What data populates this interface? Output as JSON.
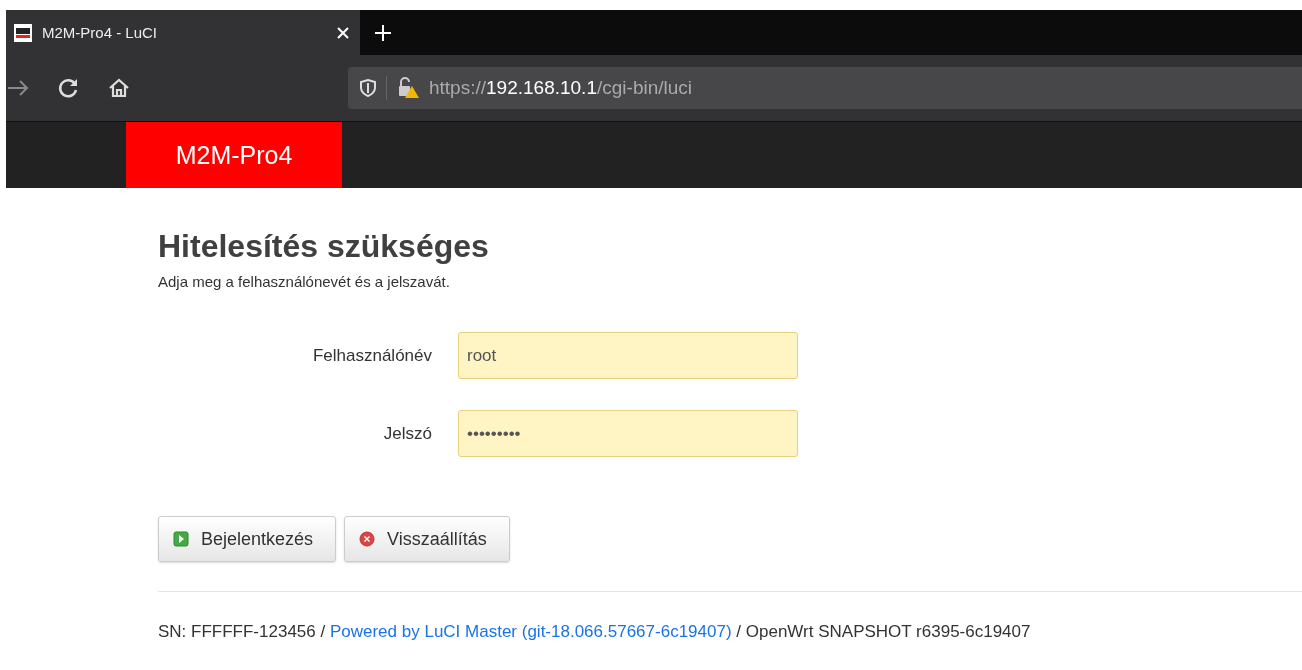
{
  "browser": {
    "tab_title": "M2M-Pro4 - LuCI",
    "url_scheme": "https://",
    "url_host": "192.168.10.1",
    "url_path": "/cgi-bin/luci"
  },
  "header": {
    "brand": "M2M-Pro4"
  },
  "title": "Hitelesítés szükséges",
  "subtitle": "Adja meg a felhasználónevét és a jelszavát.",
  "fields": [
    {
      "label": "Felhasználónév",
      "value": "root"
    },
    {
      "label": "Jelszó",
      "value": "•••••••••"
    }
  ],
  "buttons": [
    {
      "kind": "login",
      "label": "Bejelentkezés"
    },
    {
      "kind": "reset",
      "label": "Visszaállítás"
    }
  ],
  "footer": {
    "serial": "SN: FFFFFF-123456 /",
    "link": "Powered by LuCI Master (git-18.066.57667-6c19407)",
    "version": "/ OpenWrt SNAPSHOT r6395-6c19407"
  }
}
